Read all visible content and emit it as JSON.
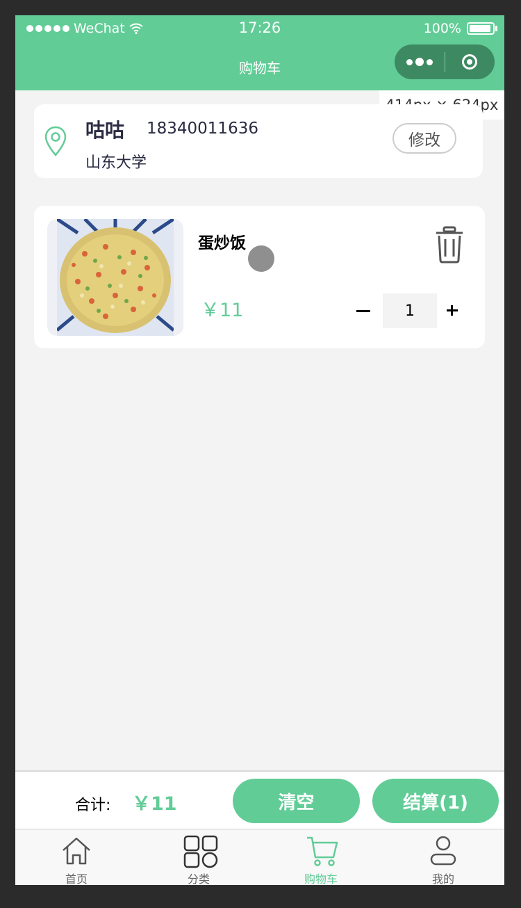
{
  "status_bar": {
    "carrier": "WeChat",
    "time": "17:26",
    "battery": "100%"
  },
  "nav": {
    "title": "购物车"
  },
  "overlay": {
    "dimensions": "414px × 624px"
  },
  "address": {
    "name": "咕咕",
    "phone": "18340011636",
    "place": "山东大学",
    "edit_label": "修改"
  },
  "cart": {
    "items": [
      {
        "name": "蛋炒饭",
        "price": "￥11",
        "quantity": "1"
      }
    ]
  },
  "checkout": {
    "total_label": "合计:",
    "total_value": "￥11",
    "clear_label": "清空",
    "pay_label": "结算(1)"
  },
  "tabs": [
    {
      "label": "首页",
      "icon": "home-icon"
    },
    {
      "label": "分类",
      "icon": "category-icon"
    },
    {
      "label": "购物车",
      "icon": "cart-icon",
      "active": true
    },
    {
      "label": "我的",
      "icon": "user-icon"
    }
  ],
  "colors": {
    "primary": "#62cc97",
    "capsule": "#3d8a62",
    "background": "#f3f3f3"
  }
}
